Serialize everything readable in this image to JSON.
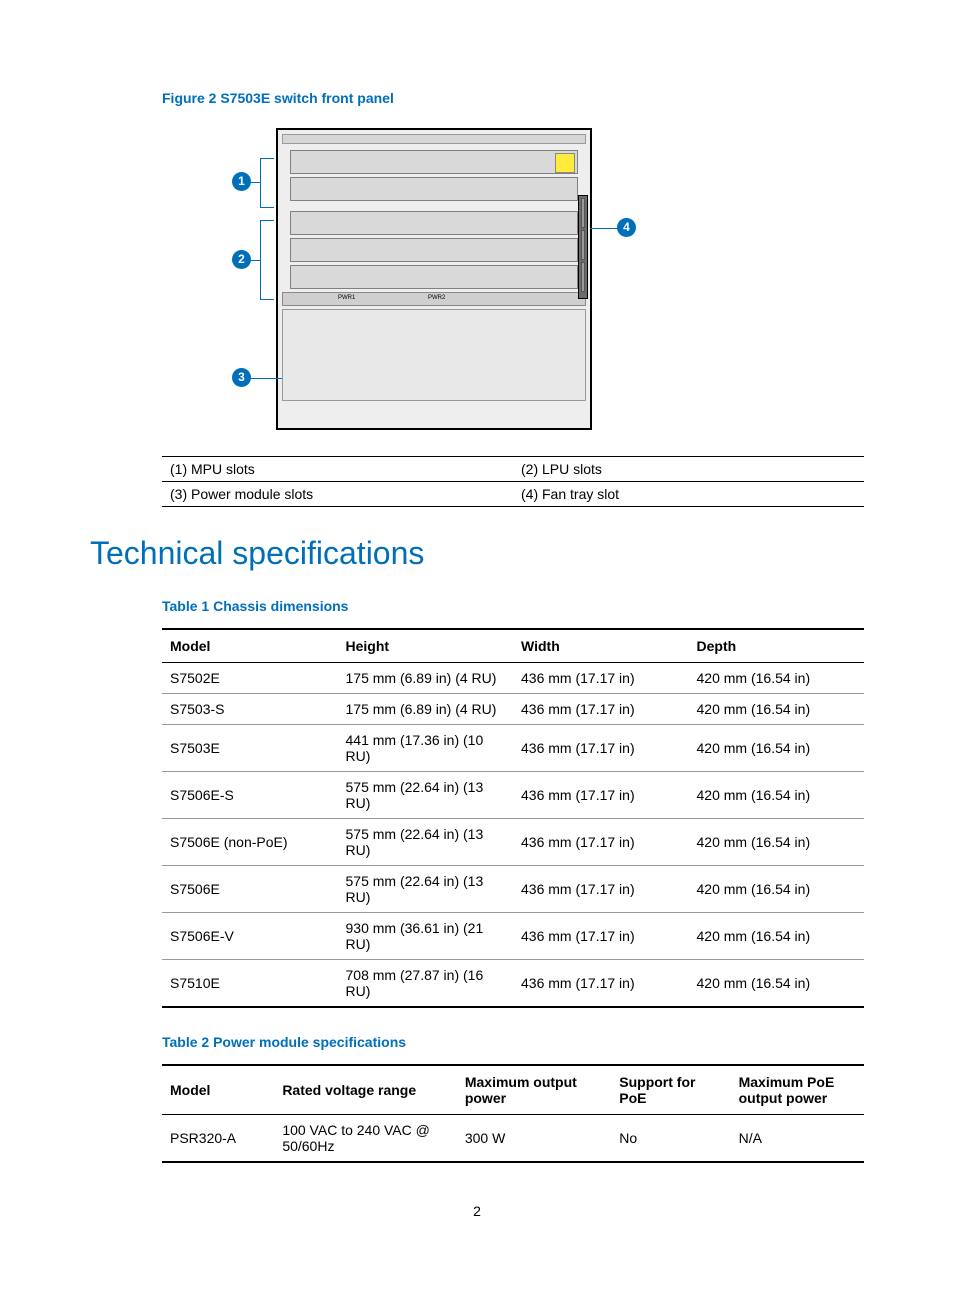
{
  "figure": {
    "caption": "Figure 2 S7503E switch front panel",
    "callouts": {
      "c1": "1",
      "c2": "2",
      "c3": "3",
      "c4": "4"
    },
    "pwr_labels": {
      "l": "PWR1",
      "r": "PWR2"
    }
  },
  "legend": {
    "r1c1": "(1) MPU slots",
    "r1c2": "(2) LPU slots",
    "r2c1": "(3) Power module slots",
    "r2c2": "(4) Fan tray slot"
  },
  "section_heading": "Technical specifications",
  "table1": {
    "caption": "Table 1 Chassis dimensions",
    "headers": {
      "h1": "Model",
      "h2": "Height",
      "h3": "Width",
      "h4": "Depth"
    },
    "rows": [
      {
        "model": "S7502E",
        "height": "175 mm (6.89 in) (4 RU)",
        "width": "436 mm (17.17 in)",
        "depth": "420 mm (16.54 in)"
      },
      {
        "model": "S7503-S",
        "height": "175 mm (6.89 in) (4 RU)",
        "width": "436 mm (17.17 in)",
        "depth": "420 mm (16.54 in)"
      },
      {
        "model": "S7503E",
        "height": "441 mm (17.36 in) (10 RU)",
        "width": "436 mm (17.17 in)",
        "depth": "420 mm (16.54 in)"
      },
      {
        "model": "S7506E-S",
        "height": "575 mm (22.64 in) (13 RU)",
        "width": "436 mm (17.17 in)",
        "depth": "420 mm (16.54 in)"
      },
      {
        "model": "S7506E (non-PoE)",
        "height": "575 mm (22.64 in) (13 RU)",
        "width": "436 mm (17.17 in)",
        "depth": "420 mm (16.54 in)"
      },
      {
        "model": "S7506E",
        "height": "575 mm (22.64 in) (13 RU)",
        "width": "436 mm (17.17 in)",
        "depth": "420 mm (16.54 in)"
      },
      {
        "model": "S7506E-V",
        "height": "930 mm (36.61 in) (21 RU)",
        "width": "436 mm (17.17 in)",
        "depth": "420 mm (16.54 in)"
      },
      {
        "model": "S7510E",
        "height": "708 mm (27.87 in) (16 RU)",
        "width": "436 mm (17.17 in)",
        "depth": "420 mm (16.54 in)"
      }
    ]
  },
  "table2": {
    "caption": "Table 2 Power module specifications",
    "headers": {
      "h1": "Model",
      "h2": "Rated voltage range",
      "h3": "Maximum output power",
      "h4": "Support for PoE",
      "h5": "Maximum PoE output power"
    },
    "rows": [
      {
        "model": "PSR320-A",
        "rvr": "100 VAC to 240 VAC @ 50/60Hz",
        "mop": "300 W",
        "poe": "No",
        "mpoe": "N/A"
      }
    ]
  },
  "page_number": "2"
}
